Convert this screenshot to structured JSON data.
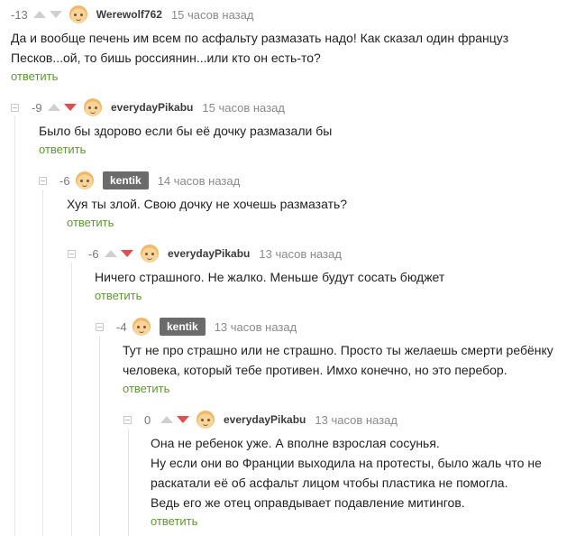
{
  "colors": {
    "reply": "#5b9a2e",
    "downvote_active": "#e04e4e",
    "vote_inactive": "#cfcfcf"
  },
  "comments": [
    {
      "rating": "-13",
      "author": "Werewolf762",
      "time": "15 часов назад",
      "lines": [
        "Да и вообще печень им всем по асфальту размазать надо! Как сказал один француз",
        "Песков...ой, то бишь россиянин...или кто он есть-то?"
      ],
      "reply": "ответить"
    },
    {
      "rating": "-9",
      "author": "everydayPikabu",
      "time": "15 часов назад",
      "lines": [
        "Было бы здорово если бы её дочку размазали бы"
      ],
      "reply": "ответить"
    },
    {
      "rating": "-6",
      "author": "kentik",
      "time": "14 часов назад",
      "lines": [
        "Хуя ты злой. Свою дочку не хочешь размазать?"
      ],
      "reply": "ответить"
    },
    {
      "rating": "-6",
      "author": "everydayPikabu",
      "time": "13 часов назад",
      "lines": [
        "Ничего страшного. Не жалко. Меньше будут сосать бюджет"
      ],
      "reply": "ответить"
    },
    {
      "rating": "-4",
      "author": "kentik",
      "time": "13 часов назад",
      "lines": [
        "Тут не про страшно или не страшно. Просто ты желаешь смерти ребёнку",
        "человека, который тебе противен. Имхо конечно, но это перебор."
      ],
      "reply": "ответить"
    },
    {
      "rating": "0",
      "author": "everydayPikabu",
      "time": "13 часов назад",
      "lines": [
        "Она не ребенок уже. А вполне взрослая сосунья.",
        "Ну если они во Франции выходила на протесты, было жаль что не",
        "раскатали её об асфальт лицом чтобы пластика не помогла.",
        "Ведь его же отец оправдывает подавление митингов."
      ],
      "reply": "ответить"
    }
  ]
}
